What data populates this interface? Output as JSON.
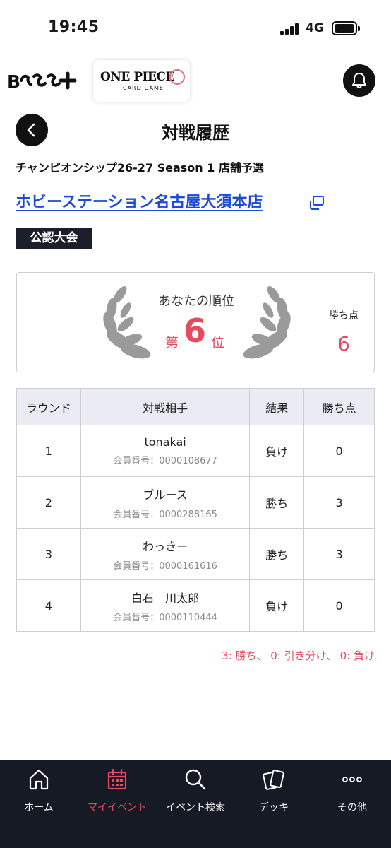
{
  "status_bar": {
    "time": "19:45",
    "network": "4G",
    "battery_level": 1.0
  },
  "header": {
    "brand_logo_text": "B★CG+",
    "game_logo_title": "ONE PIECE",
    "game_logo_subtitle": "CARD GAME"
  },
  "page": {
    "title": "対戦履歴",
    "event_name": "チャンピオンシップ26-27 Season 1 店舗予選",
    "store_name": "ホビーステーション名古屋大須本店",
    "badge": "公認大会"
  },
  "rank": {
    "caption": "あなたの順位",
    "prefix": "第",
    "number": "6",
    "suffix": "位",
    "points_label": "勝ち点",
    "points_value": "6"
  },
  "table": {
    "headers": {
      "round": "ラウンド",
      "opponent": "対戦相手",
      "result": "結果",
      "points": "勝ち点"
    },
    "rows": [
      {
        "round": "1",
        "opponent": "tonakai",
        "member": "会員番号：0000108677",
        "result": "負け",
        "points": "0"
      },
      {
        "round": "2",
        "opponent": "ブルース",
        "member": "会員番号：0000288165",
        "result": "勝ち",
        "points": "3"
      },
      {
        "round": "3",
        "opponent": "わっきー",
        "member": "会員番号：0000161616",
        "result": "勝ち",
        "points": "3"
      },
      {
        "round": "4",
        "opponent": "白石　川太郎",
        "member": "会員番号：0000110444",
        "result": "負け",
        "points": "0"
      }
    ]
  },
  "legend": "3: 勝ち、 0: 引き分け、 0: 負け",
  "bottom_nav": {
    "items": [
      {
        "label": "ホーム",
        "icon": "home-icon"
      },
      {
        "label": "マイイベント",
        "icon": "calendar-icon",
        "active": true
      },
      {
        "label": "イベント検索",
        "icon": "search-icon"
      },
      {
        "label": "デッキ",
        "icon": "cards-icon"
      },
      {
        "label": "その他",
        "icon": "more-icon"
      }
    ]
  },
  "colors": {
    "accent": "#e64a5f",
    "link": "#1d4bd6",
    "nav_background": "#161a24",
    "badge_background": "#1a1f2b"
  }
}
